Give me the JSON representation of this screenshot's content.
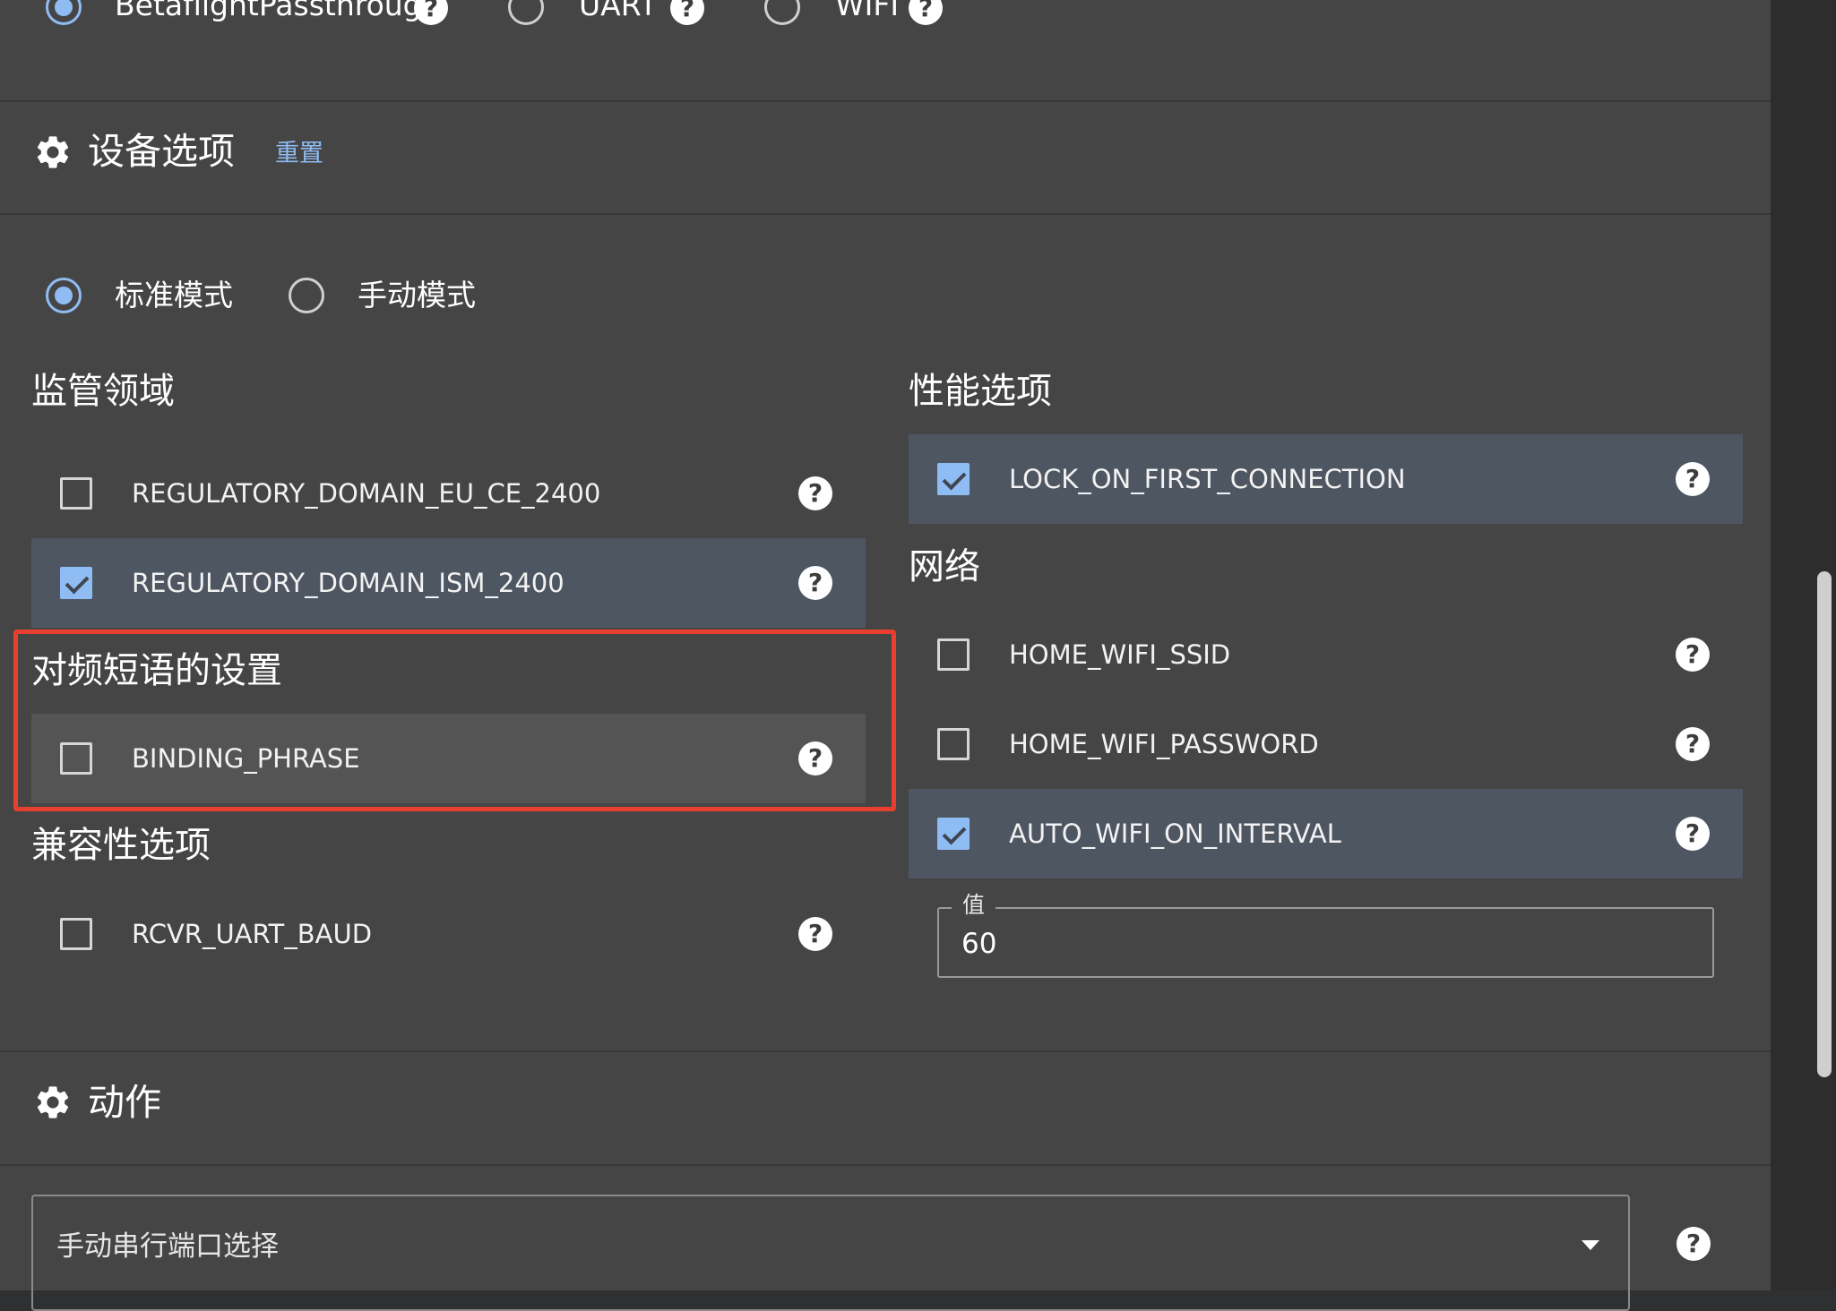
{
  "top_radio": {
    "items": [
      {
        "label": "BetaflightPassthrough",
        "selected": true
      },
      {
        "label": "UART",
        "selected": false
      },
      {
        "label": "WIFI",
        "selected": false
      }
    ]
  },
  "device_options": {
    "title": "设备选项",
    "reset_label": "重置",
    "icon": "gear-icon"
  },
  "mode": {
    "standard_label": "标准模式",
    "manual_label": "手动模式",
    "selected": "standard"
  },
  "regulatory": {
    "title": "监管领域",
    "items": [
      {
        "label": "REGULATORY_DOMAIN_EU_CE_2400",
        "checked": false
      },
      {
        "label": "REGULATORY_DOMAIN_ISM_2400",
        "checked": true
      }
    ]
  },
  "binding": {
    "title": "对频短语的设置",
    "items": [
      {
        "label": "BINDING_PHRASE",
        "checked": false
      }
    ]
  },
  "compat": {
    "title": "兼容性选项",
    "items": [
      {
        "label": "RCVR_UART_BAUD",
        "checked": false
      }
    ]
  },
  "performance": {
    "title": "性能选项",
    "items": [
      {
        "label": "LOCK_ON_FIRST_CONNECTION",
        "checked": true
      }
    ]
  },
  "network": {
    "title": "网络",
    "items": [
      {
        "label": "HOME_WIFI_SSID",
        "checked": false
      },
      {
        "label": "HOME_WIFI_PASSWORD",
        "checked": false
      },
      {
        "label": "AUTO_WIFI_ON_INTERVAL",
        "checked": true
      }
    ],
    "value_field": {
      "legend": "值",
      "value": "60"
    }
  },
  "actions": {
    "title": "动作",
    "icon": "gear-icon",
    "serial_select_placeholder": "手动串行端口选择"
  },
  "help_glyph": "?",
  "colors": {
    "accent": "#8fbcf2",
    "highlight": "#e8402f",
    "panel": "#454545"
  }
}
